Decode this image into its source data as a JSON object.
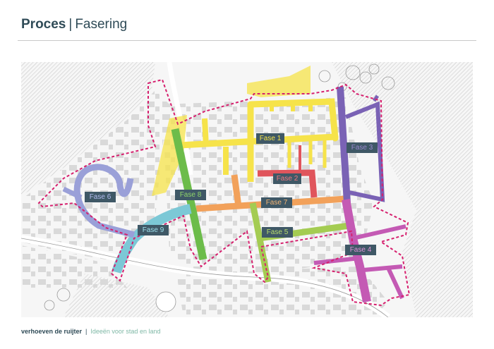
{
  "header": {
    "title_bold": "Proces",
    "separator": "|",
    "title_rest": "Fasering"
  },
  "footer": {
    "brand": "verhoeven de ruijter",
    "separator": "|",
    "tagline": "Ideeën voor stad en land"
  },
  "phases": [
    {
      "label": "Fase 1",
      "color": "#f6e34a",
      "text_color": "#f6e34a"
    },
    {
      "label": "Fase 2",
      "color": "#e0555c",
      "text_color": "#f07a80"
    },
    {
      "label": "Fase 3",
      "color": "#7a62b5",
      "text_color": "#9a8ad0"
    },
    {
      "label": "Fase 4",
      "color": "#c45ab4",
      "text_color": "#e092d8"
    },
    {
      "label": "Fase 5",
      "color": "#a4cc52",
      "text_color": "#b7dc6c"
    },
    {
      "label": "Fase 6",
      "color": "#9aa0d8",
      "text_color": "#b4bdf0"
    },
    {
      "label": "Fase 7",
      "color": "#f2a15a",
      "text_color": "#f6b574"
    },
    {
      "label": "Fase 8",
      "color": "#6cbc4a",
      "text_color": "#8fd46a"
    },
    {
      "label": "Fase 9",
      "color": "#7cc8d6",
      "text_color": "#9fe0ec"
    }
  ],
  "map_colors": {
    "boundary": "#d6206e",
    "buildings": "#d8d8d8",
    "hatch": "#c0c0c0"
  }
}
